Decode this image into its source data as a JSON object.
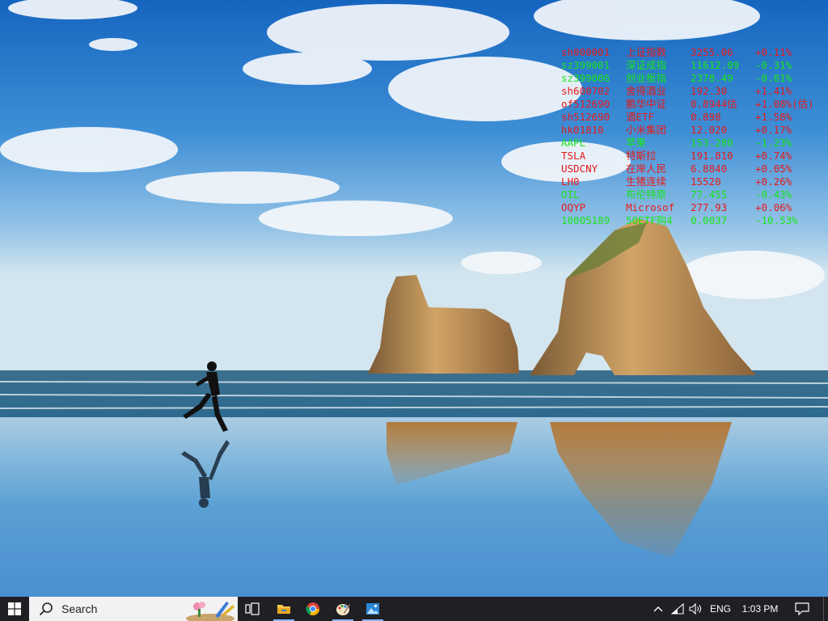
{
  "desktop": {
    "wallpaper_icon": "beach-runner-wallpaper"
  },
  "colors": {
    "up": "#e81a1a",
    "down": "#19e619",
    "taskbar": "#1f1f24",
    "search_bg": "#f2f2f2"
  },
  "ticker": {
    "rows": [
      {
        "code": "sh000001",
        "name": "上证指数",
        "price": "3255.06",
        "change": "+0.11%",
        "trend": "up"
      },
      {
        "code": "sz399001",
        "name": "深证成指",
        "price": "11612.09",
        "change": "-0.31%",
        "trend": "down"
      },
      {
        "code": "sz399006",
        "name": "创业板指",
        "price": "2378.49",
        "change": "-0.81%",
        "trend": "down"
      },
      {
        "code": "sh600702",
        "name": "舍得酒业",
        "price": "192.30",
        "change": "+1.41%",
        "trend": "up"
      },
      {
        "code": "of512690",
        "name": "鹏华中证",
        "price": "0.8944估",
        "change": "+1.08%(估)",
        "trend": "up"
      },
      {
        "code": "sh512690",
        "name": "酒ETF",
        "price": "0.898",
        "change": "+1.58%",
        "trend": "up"
      },
      {
        "code": "hk01810",
        "name": "小米集团",
        "price": "12.020",
        "change": "+0.17%",
        "trend": "up"
      },
      {
        "code": "AAPL",
        "name": "苹果",
        "price": "153.280",
        "change": "-1.23%",
        "trend": "down"
      },
      {
        "code": "TSLA",
        "name": "特斯拉",
        "price": "191.810",
        "change": "+0.74%",
        "trend": "up"
      },
      {
        "code": "USDCNY",
        "name": "在岸人民",
        "price": "6.8840",
        "change": "+0.05%",
        "trend": "up"
      },
      {
        "code": "LH0",
        "name": "生猪连续",
        "price": "15520",
        "change": "+0.26%",
        "trend": "up"
      },
      {
        "code": "OIL",
        "name": "布伦特原",
        "price": "77.455",
        "change": "-0.43%",
        "trend": "down"
      },
      {
        "code": "OQYP",
        "name": "Microsof",
        "price": "277.93",
        "change": "+0.06%",
        "trend": "up"
      },
      {
        "code": "10005189",
        "name": "50ETF购4",
        "price": "0.0037",
        "change": "-10.53%",
        "trend": "down"
      }
    ]
  },
  "taskbar": {
    "start_icon": "windows-logo-icon",
    "search_placeholder": "Search",
    "search_icon": "search-icon",
    "taskview_icon": "task-view-icon",
    "apps": [
      {
        "name": "File Explorer",
        "icon": "folder-icon"
      },
      {
        "name": "Google Chrome",
        "icon": "chrome-icon"
      },
      {
        "name": "Paint",
        "icon": "paint-icon"
      },
      {
        "name": "Photos",
        "icon": "photos-icon"
      }
    ],
    "tray": {
      "chevron_icon": "chevron-up-icon",
      "network_icon": "network-icon",
      "volume_icon": "volume-icon",
      "language": "ENG",
      "time": "1:03 PM",
      "action_center_icon": "action-center-icon"
    }
  }
}
